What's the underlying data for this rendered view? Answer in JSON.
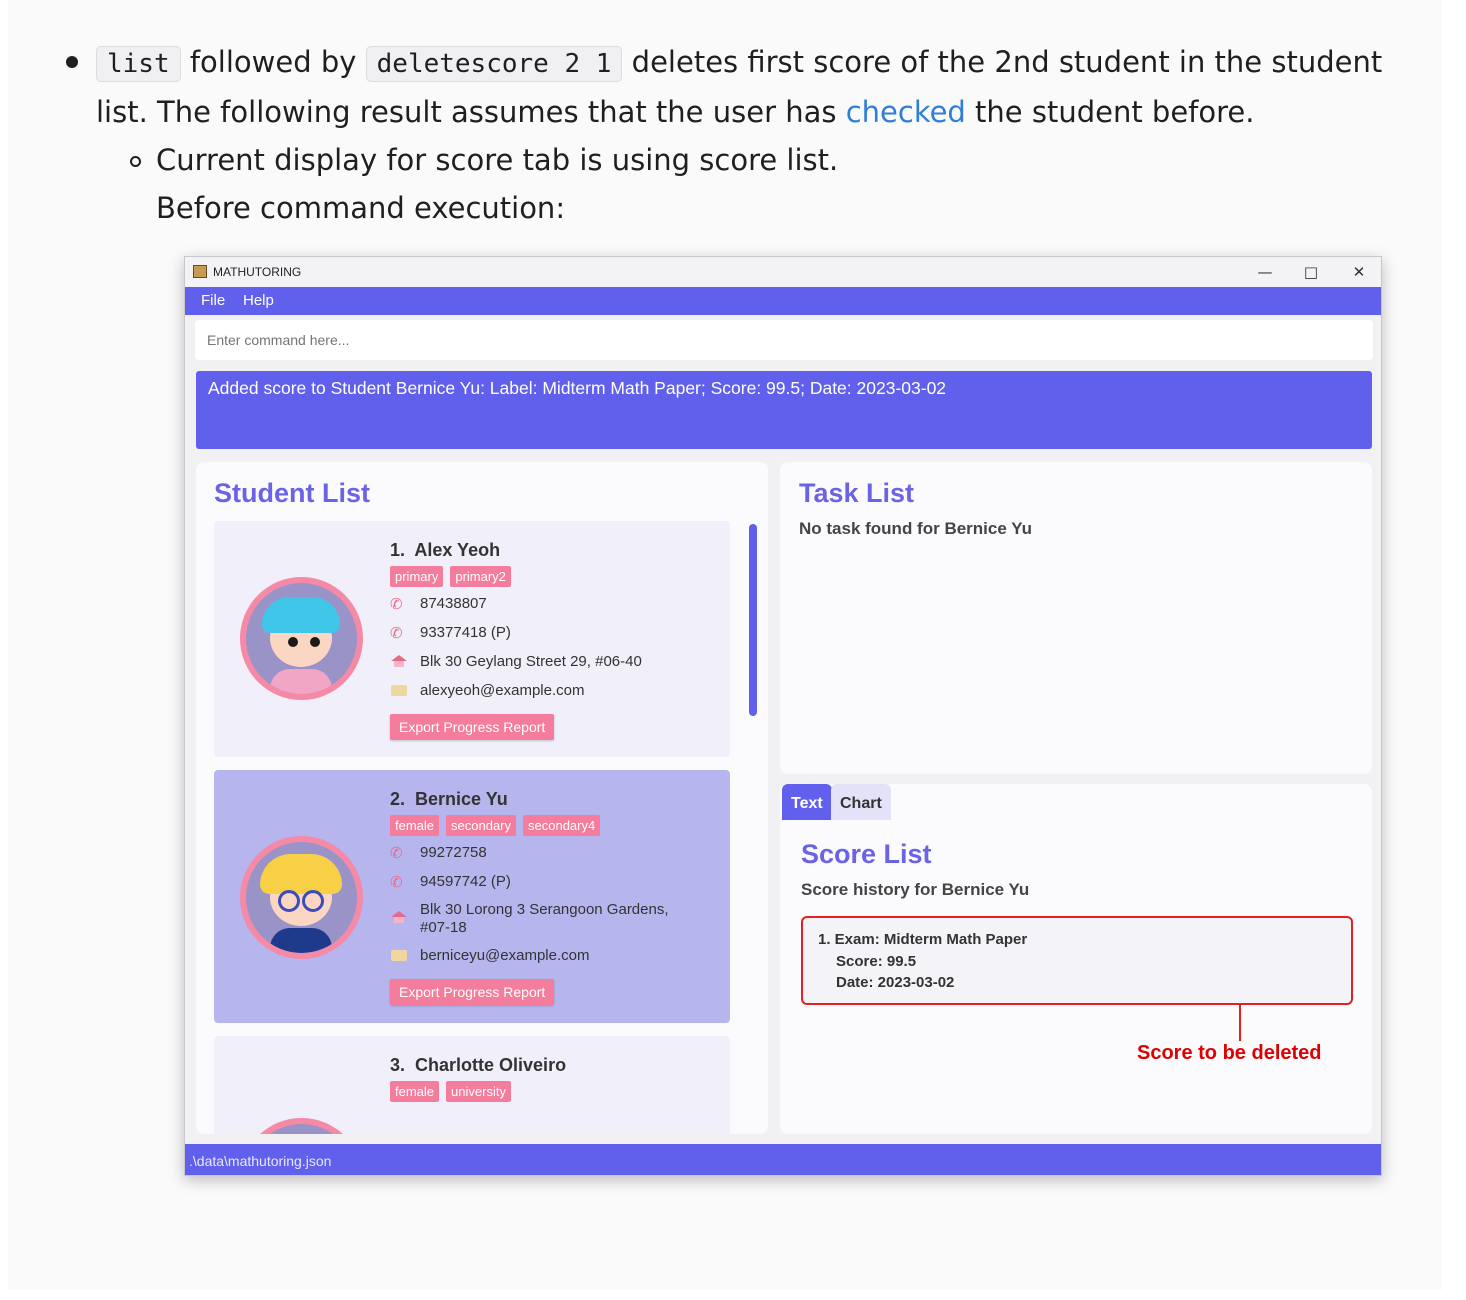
{
  "doc": {
    "bullet_code1": "list",
    "bullet_text1": "followed by",
    "bullet_code2": "deletescore 2 1",
    "bullet_text2": "deletes first score of the 2nd student in the student",
    "line2_before": "list. The following result assumes that the user has",
    "line2_link": "checked",
    "line2_after": "the student before.",
    "sub_bullet": "Current display for score tab is using score list.",
    "sub_line2": "Before command execution:"
  },
  "app": {
    "window_title": "MATHUTORING",
    "menu": [
      "File",
      "Help"
    ],
    "command_placeholder": "Enter command here...",
    "result_message": "Added score to Student Bernice Yu: Label: Midterm Math Paper; Score: 99.5; Date: 2023-03-02",
    "status_path": ".\\data\\mathutoring.json",
    "colors": {
      "accent": "#6060ec",
      "tag": "#f47c9c",
      "highlight": "#e52020",
      "selected_card": "#b7b5ee"
    }
  },
  "student_list": {
    "title": "Student List",
    "students": [
      {
        "index": "1.",
        "name": "Alex Yeoh",
        "tags": [
          "primary",
          "primary2"
        ],
        "phone": "87438807",
        "parent_phone": "93377418 (P)",
        "address": "Blk 30 Geylang Street 29, #06-40",
        "email": "alexyeoh@example.com",
        "export_label": "Export Progress Report"
      },
      {
        "index": "2.",
        "name": "Bernice Yu",
        "tags": [
          "female",
          "secondary",
          "secondary4"
        ],
        "phone": "99272758",
        "parent_phone": "94597742 (P)",
        "address_line1": "Blk 30 Lorong 3 Serangoon Gardens,",
        "address_line2": "#07-18",
        "email": "berniceyu@example.com",
        "export_label": "Export Progress Report"
      },
      {
        "index": "3.",
        "name": "Charlotte Oliveiro",
        "tags": [
          "female",
          "university"
        ]
      }
    ]
  },
  "task_list": {
    "title": "Task List",
    "subtitle": "No task found for Bernice Yu"
  },
  "score_panel": {
    "tabs": [
      "Text",
      "Chart"
    ],
    "title": "Score List",
    "subtitle": "Score history for Bernice Yu",
    "entry_exam": "1. Exam: Midterm Math Paper",
    "entry_score": "Score: 99.5",
    "entry_date": "Date: 2023-03-02",
    "callout": "Score to be deleted"
  }
}
